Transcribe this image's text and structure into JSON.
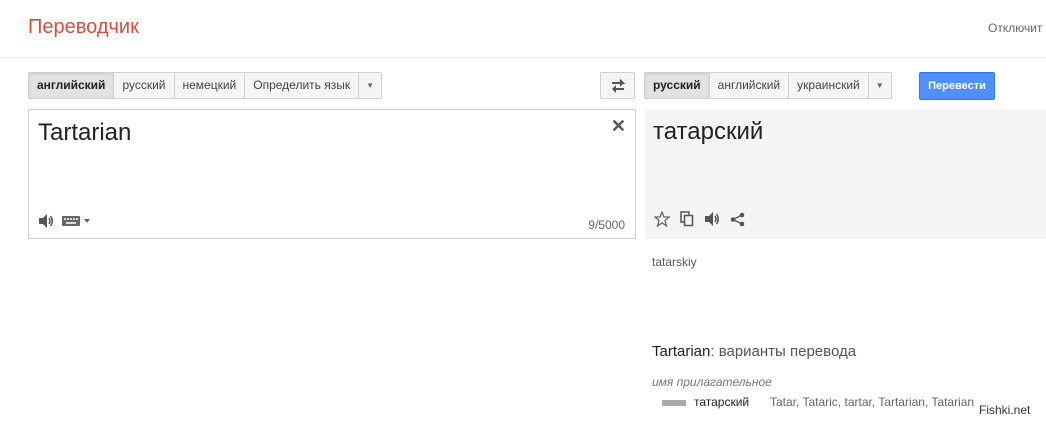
{
  "header": {
    "logo": "Переводчик",
    "signout": "Отключит"
  },
  "source": {
    "languages": [
      "английский",
      "русский",
      "немецкий",
      "Определить язык"
    ],
    "active_index": 0,
    "text": "Tartarian",
    "char_count": "9/5000"
  },
  "target": {
    "languages": [
      "русский",
      "английский",
      "украинский"
    ],
    "active_index": 0,
    "text": "татарский",
    "transliteration": "tatarskiy"
  },
  "toolbar": {
    "translate_label": "Перевести"
  },
  "icons": {
    "swap": "swap-icon",
    "clear": "close-icon",
    "listen": "speaker-icon",
    "keyboard": "keyboard-icon",
    "star": "star-icon",
    "copy": "copy-icon",
    "share": "share-icon"
  },
  "variants": {
    "word": "Tartarian",
    "title_suffix": ": варианты перевода",
    "part_of_speech": "имя прилагательное",
    "entries": [
      {
        "word": "татарский",
        "back": "Tatar, Tataric, tartar, Tartarian, Tatarian"
      }
    ]
  },
  "watermark": "Fishki.net",
  "colors": {
    "logo": "#dd4b39",
    "primary_button": "#4d90fe"
  }
}
